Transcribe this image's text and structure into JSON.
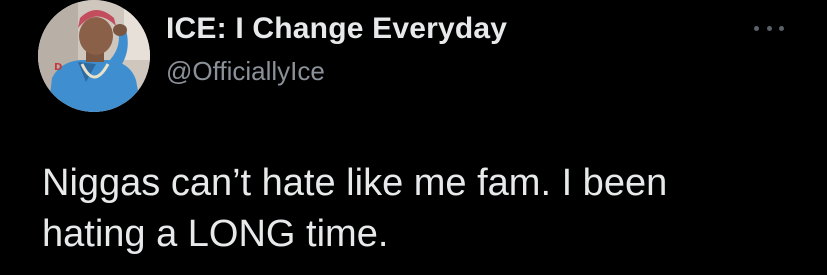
{
  "tweet": {
    "author": {
      "display_name": "ICE: I Change Everyday",
      "handle": "@OfficiallyIce",
      "avatar_icon": "user-avatar-photo"
    },
    "more_icon": "more-options-icon",
    "text": "Niggas can’t hate like me fam. I been\nhating a LONG time."
  },
  "colors": {
    "background": "#000000",
    "primary_text": "#e7e9ea",
    "secondary_text": "#8b9198"
  }
}
